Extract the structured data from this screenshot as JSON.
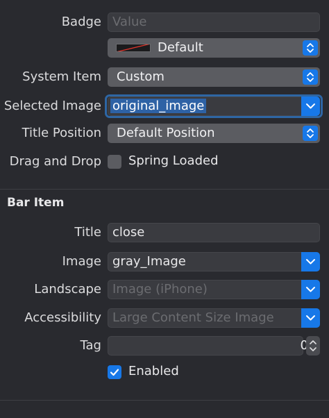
{
  "window": {
    "title": ""
  },
  "tab_bar_item": {
    "badge": {
      "label": "Badge",
      "placeholder": "Value",
      "value": ""
    },
    "badge_color": {
      "value": "Default"
    },
    "system_item": {
      "label": "System Item",
      "value": "Custom"
    },
    "selected_image": {
      "label": "Selected Image",
      "value": "original_image"
    },
    "title_position": {
      "label": "Title Position",
      "value": "Default Position"
    },
    "drag_and_drop": {
      "label": "Drag and Drop",
      "option": "Spring Loaded",
      "checked": false
    }
  },
  "bar_item": {
    "section_title": "Bar Item",
    "title": {
      "label": "Title",
      "value": "close"
    },
    "image": {
      "label": "Image",
      "value": "gray_Image"
    },
    "landscape": {
      "label": "Landscape",
      "placeholder": "Image (iPhone)"
    },
    "accessibility": {
      "label": "Accessibility",
      "placeholder": "Large Content Size Image"
    },
    "tag": {
      "label": "Tag",
      "value": "0"
    },
    "enabled": {
      "label": "Enabled",
      "checked": true
    }
  },
  "colors": {
    "background": "#292a2f",
    "accent": "#1778e8",
    "popup": "#5b5c61",
    "field": "#3a3b40",
    "selection": "#2e62a5"
  },
  "icons": {
    "popup_arrows": "updown-chevron-icon",
    "combo_arrow": "chevron-down-icon",
    "stepper": "stepper-icon",
    "checkmark": "checkmark-icon"
  }
}
